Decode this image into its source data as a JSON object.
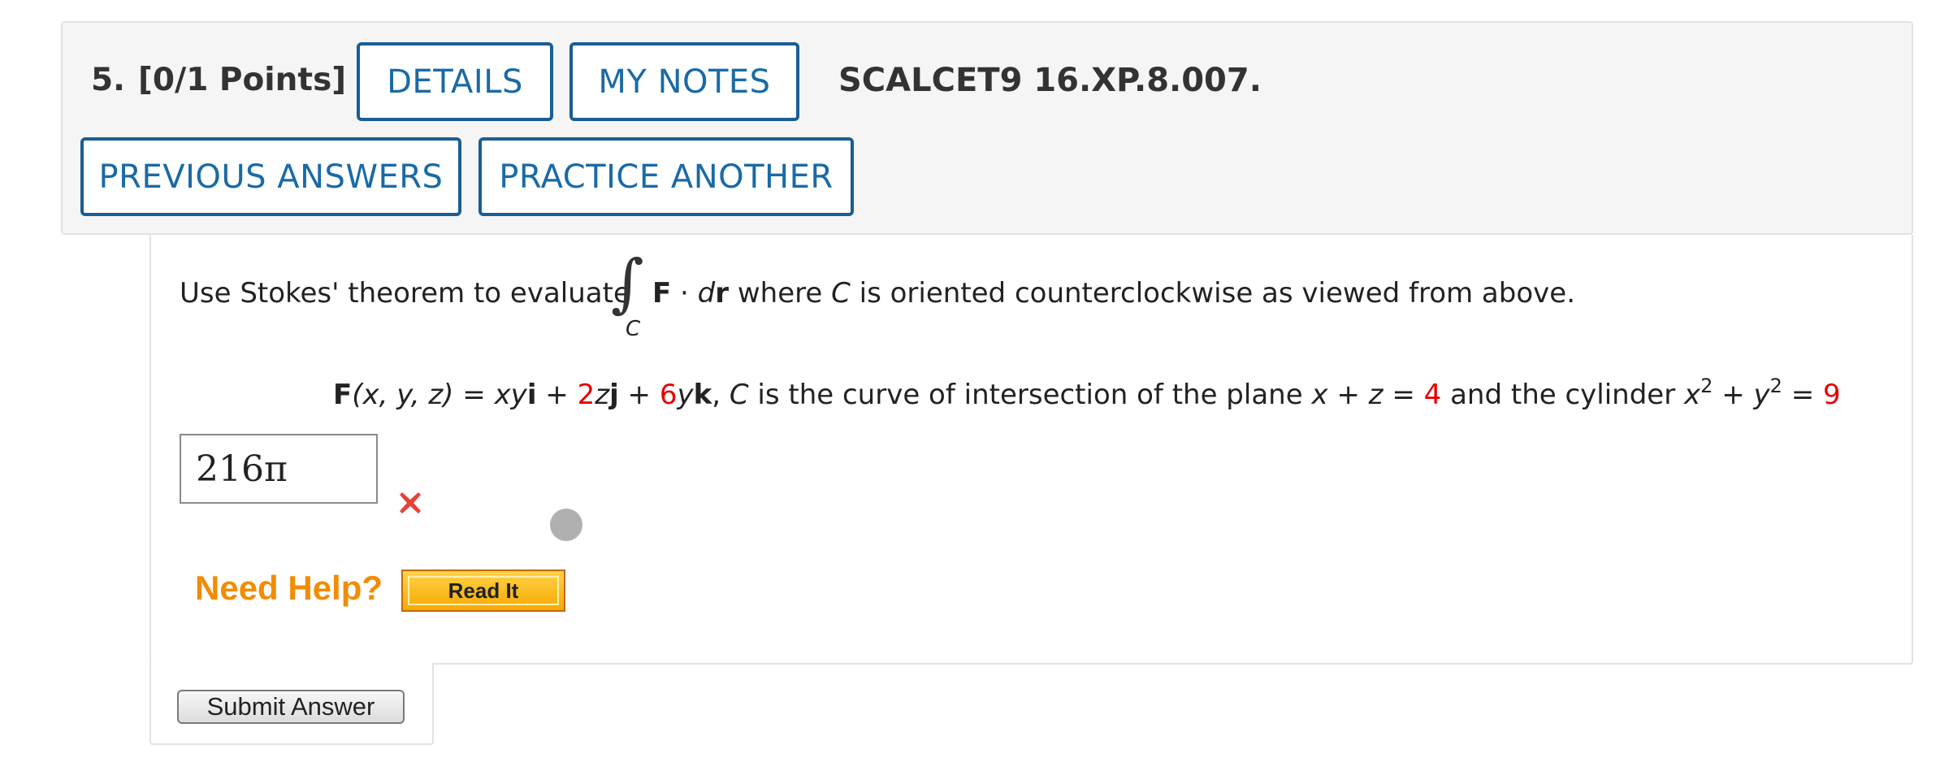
{
  "header": {
    "question_number": "5.",
    "points": "[0/1 Points]",
    "details_label": "DETAILS",
    "my_notes_label": "MY NOTES",
    "question_code": "SCALCET9 16.XP.8.007.",
    "previous_answers_label": "PREVIOUS ANSWERS",
    "practice_another_label": "PRACTICE ANOTHER"
  },
  "question": {
    "intro": "Use Stokes' theorem to evaluate",
    "integral_symbol": "∫",
    "integral_subscript": "C",
    "F_bold": "F",
    "dot": " · ",
    "d": "d",
    "r_bold": "r",
    "where": " where ",
    "C": "C",
    "rest": " is oriented counterclockwise as viewed from above."
  },
  "formula": {
    "F": "F",
    "args": "(x, y, z)",
    "eq": " = ",
    "xy": "xy",
    "i": "i",
    "plus1": " + ",
    "coef_j": "2",
    "z": "z",
    "j": "j",
    "plus2": " + ",
    "coef_k": "6",
    "y": "y",
    "k": "k",
    "comma": ",   ",
    "C": "C",
    "curve_text": " is the curve of intersection of the plane ",
    "plane": "x + z",
    "eq2": " = ",
    "plane_value": "4",
    "and_text": " and the cylinder ",
    "x": "x",
    "exp1": "2",
    "plus3": " + ",
    "y2": "y",
    "exp2": "2",
    "eq3": " = ",
    "cyl_value": "9"
  },
  "answer": {
    "value": "216π",
    "status_icon": "wrong-x-icon",
    "status_color": "#e8413a"
  },
  "help": {
    "need_help_label": "Need Help?",
    "read_it_label": "Read It"
  },
  "submit_label": "Submit Answer",
  "colors": {
    "accent": "#1a6aa6",
    "help_orange": "#f28c00",
    "red_value": "#e60000"
  }
}
